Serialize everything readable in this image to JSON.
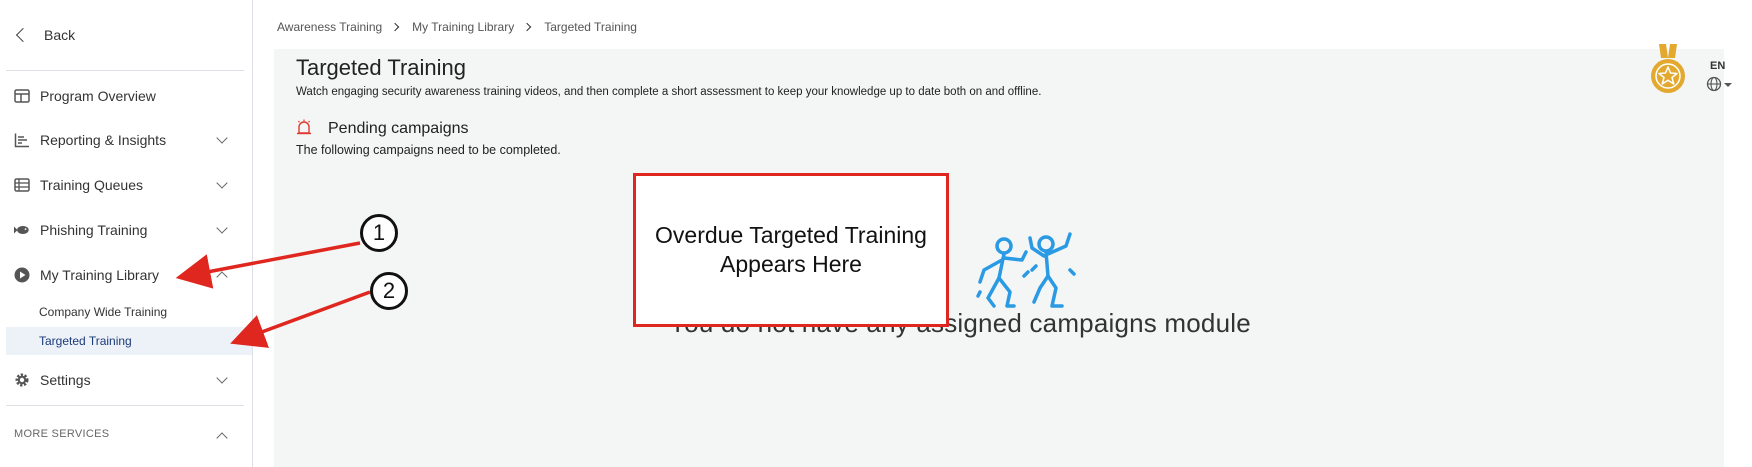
{
  "sidebar": {
    "back_label": "Back",
    "items": [
      {
        "label": "Program Overview",
        "icon": "layout-icon"
      },
      {
        "label": "Reporting & Insights",
        "icon": "chart-icon"
      },
      {
        "label": "Training Queues",
        "icon": "list-icon"
      },
      {
        "label": "Phishing Training",
        "icon": "fish-icon"
      },
      {
        "label": "My Training Library",
        "icon": "play-circle-icon"
      },
      {
        "label": "Settings",
        "icon": "gear-icon"
      }
    ],
    "sub_items": [
      {
        "label": "Company Wide Training",
        "active": false
      },
      {
        "label": "Targeted Training",
        "active": true
      }
    ],
    "more_label": "MORE SERVICES"
  },
  "breadcrumb": [
    "Awareness Training",
    "My Training Library",
    "Targeted Training"
  ],
  "page": {
    "title": "Targeted Training",
    "subtitle": "Watch engaging security awareness training videos, and then complete a short assessment to keep your knowledge up to date both on and offline.",
    "pending_title": "Pending campaigns",
    "pending_desc": "The following campaigns need to be completed.",
    "empty_message": "You do not have any assigned campaigns module",
    "language": "EN"
  },
  "annotations": {
    "box_text": "Overdue Targeted Training Appears Here",
    "callouts": [
      "1",
      "2"
    ]
  },
  "colors": {
    "accent": "#1b3a78",
    "annotation_red": "#e0271f",
    "illustration_blue": "#2a9ae4",
    "medal_gold": "#e3a92f",
    "alert_red": "#e0382f"
  }
}
